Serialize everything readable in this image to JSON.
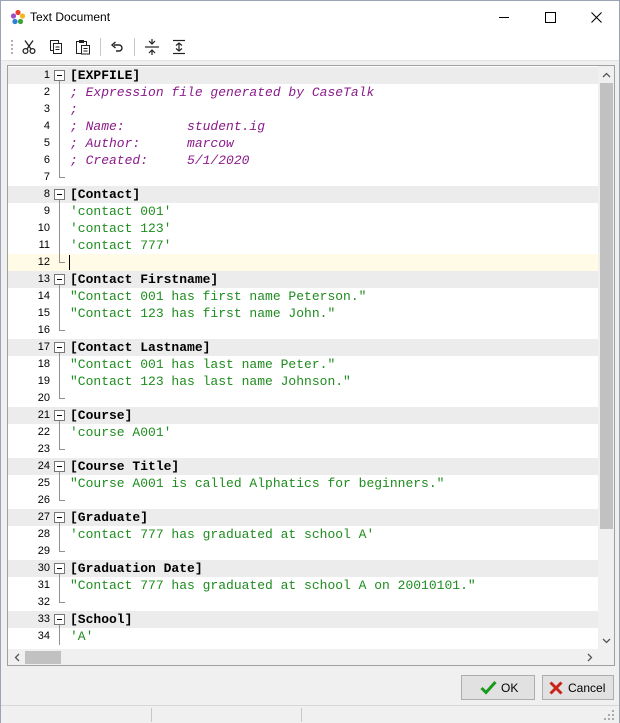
{
  "window": {
    "title": "Text Document"
  },
  "toolbar": {
    "items": [
      {
        "icon": "cut-icon"
      },
      {
        "icon": "copy-icon"
      },
      {
        "icon": "paste-icon"
      },
      {
        "icon": "undo-icon"
      },
      {
        "icon": "collapse-all-icon"
      },
      {
        "icon": "expand-all-icon"
      }
    ]
  },
  "editor": {
    "cursor_line": 12,
    "lines": [
      {
        "n": "1",
        "text": "[EXPFILE]",
        "kind": "section"
      },
      {
        "n": "2",
        "text": "; Expression file generated by CaseTalk",
        "kind": "comment"
      },
      {
        "n": "3",
        "text": ";",
        "kind": "comment"
      },
      {
        "n": "4",
        "text": "; Name:        student.ig",
        "kind": "comment"
      },
      {
        "n": "5",
        "text": "; Author:      marcow",
        "kind": "comment"
      },
      {
        "n": "6",
        "text": "; Created:     5/1/2020",
        "kind": "comment"
      },
      {
        "n": "7",
        "text": "",
        "kind": "blank"
      },
      {
        "n": "8",
        "text": "[Contact]",
        "kind": "section"
      },
      {
        "n": "9",
        "text": "'contact 001'",
        "kind": "string"
      },
      {
        "n": "10",
        "text": "'contact 123'",
        "kind": "string"
      },
      {
        "n": "11",
        "text": "'contact 777'",
        "kind": "string"
      },
      {
        "n": "12",
        "text": "",
        "kind": "blank"
      },
      {
        "n": "13",
        "text": "[Contact Firstname]",
        "kind": "section"
      },
      {
        "n": "14",
        "text": "\"Contact 001 has first name Peterson.\"",
        "kind": "string"
      },
      {
        "n": "15",
        "text": "\"Contact 123 has first name John.\"",
        "kind": "string"
      },
      {
        "n": "16",
        "text": "",
        "kind": "blank"
      },
      {
        "n": "17",
        "text": "[Contact Lastname]",
        "kind": "section"
      },
      {
        "n": "18",
        "text": "\"Contact 001 has last name Peter.\"",
        "kind": "string"
      },
      {
        "n": "19",
        "text": "\"Contact 123 has last name Johnson.\"",
        "kind": "string"
      },
      {
        "n": "20",
        "text": "",
        "kind": "blank"
      },
      {
        "n": "21",
        "text": "[Course]",
        "kind": "section"
      },
      {
        "n": "22",
        "text": "'course A001'",
        "kind": "string"
      },
      {
        "n": "23",
        "text": "",
        "kind": "blank"
      },
      {
        "n": "24",
        "text": "[Course Title]",
        "kind": "section"
      },
      {
        "n": "25",
        "text": "\"Course A001 is called Alphatics for beginners.\"",
        "kind": "string"
      },
      {
        "n": "26",
        "text": "",
        "kind": "blank"
      },
      {
        "n": "27",
        "text": "[Graduate]",
        "kind": "section"
      },
      {
        "n": "28",
        "text": "'contact 777 has graduated at school A'",
        "kind": "string"
      },
      {
        "n": "29",
        "text": "",
        "kind": "blank"
      },
      {
        "n": "30",
        "text": "[Graduation Date]",
        "kind": "section"
      },
      {
        "n": "31",
        "text": "\"Contact 777 has graduated at school A on 20010101.\"",
        "kind": "string"
      },
      {
        "n": "32",
        "text": "",
        "kind": "blank"
      },
      {
        "n": "33",
        "text": "[School]",
        "kind": "section"
      },
      {
        "n": "34",
        "text": "'A'",
        "kind": "string"
      }
    ]
  },
  "buttons": {
    "ok_label": "OK",
    "cancel_label": "Cancel"
  },
  "colors": {
    "comment": "#8b1a8b",
    "string": "#1e8c1e",
    "ok_check": "#1a9a1a",
    "cancel_x": "#c8241c"
  }
}
